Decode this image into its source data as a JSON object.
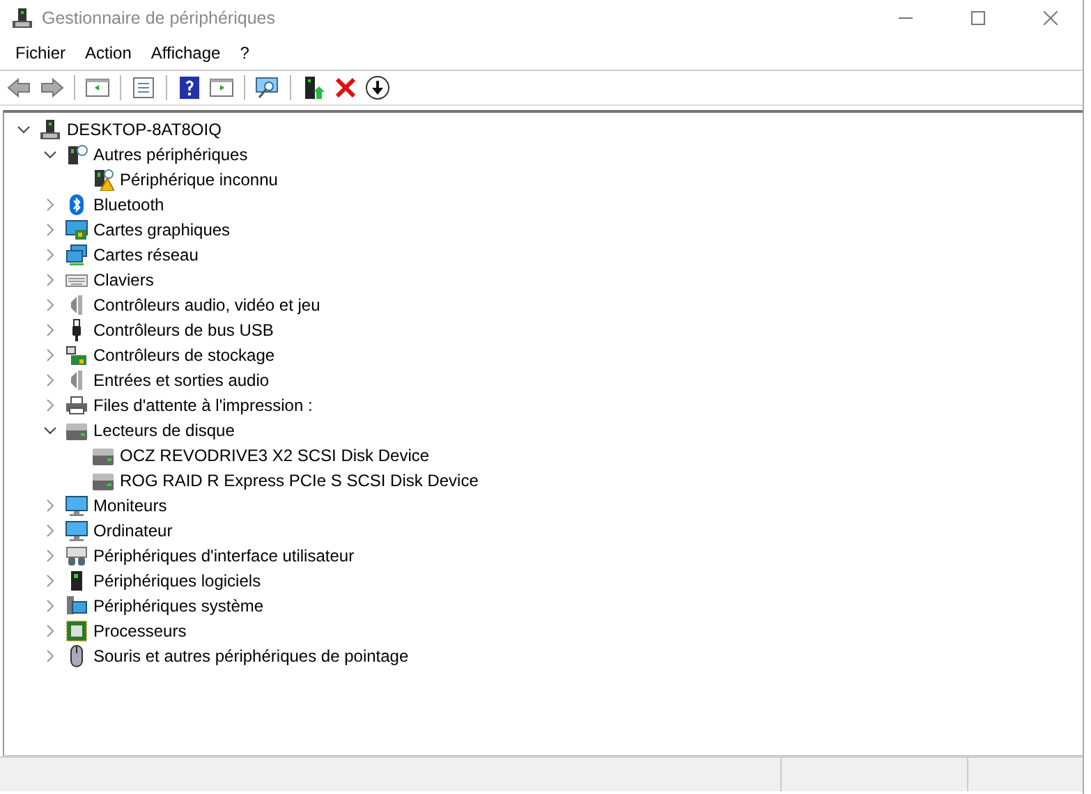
{
  "window": {
    "title": "Gestionnaire de périphériques"
  },
  "menu": [
    "Fichier",
    "Action",
    "Affichage",
    "?"
  ],
  "tree": [
    {
      "label": "DESKTOP-8AT8OIQ",
      "kind": "computer",
      "expanded": true,
      "children": [
        {
          "label": "Autres périphériques",
          "kind": "unknown",
          "expanded": true,
          "children": [
            {
              "label": "Périphérique inconnu",
              "kind": "warning"
            }
          ]
        },
        {
          "label": "Bluetooth",
          "kind": "bluetooth",
          "expanded": false
        },
        {
          "label": "Cartes graphiques",
          "kind": "display",
          "expanded": false
        },
        {
          "label": "Cartes réseau",
          "kind": "network",
          "expanded": false
        },
        {
          "label": "Claviers",
          "kind": "keyboard",
          "expanded": false
        },
        {
          "label": "Contrôleurs audio, vidéo et jeu",
          "kind": "speaker",
          "expanded": false
        },
        {
          "label": "Contrôleurs de bus USB",
          "kind": "usb",
          "expanded": false
        },
        {
          "label": "Contrôleurs de stockage",
          "kind": "storage",
          "expanded": false
        },
        {
          "label": "Entrées et sorties audio",
          "kind": "speaker",
          "expanded": false
        },
        {
          "label": "Files d'attente à l'impression :",
          "kind": "printer",
          "expanded": false
        },
        {
          "label": "Lecteurs de disque",
          "kind": "disk",
          "expanded": true,
          "children": [
            {
              "label": "OCZ REVODRIVE3 X2 SCSI Disk Device",
              "kind": "disk"
            },
            {
              "label": "ROG RAID R Express PCIe S SCSI Disk Device",
              "kind": "disk"
            }
          ]
        },
        {
          "label": "Moniteurs",
          "kind": "monitor",
          "expanded": false
        },
        {
          "label": "Ordinateur",
          "kind": "monitor",
          "expanded": false
        },
        {
          "label": "Périphériques d'interface utilisateur",
          "kind": "hid",
          "expanded": false
        },
        {
          "label": "Périphériques logiciels",
          "kind": "software",
          "expanded": false
        },
        {
          "label": "Périphériques système",
          "kind": "system",
          "expanded": false
        },
        {
          "label": "Processeurs",
          "kind": "processor",
          "expanded": false
        },
        {
          "label": "Souris et autres périphériques de pointage",
          "kind": "mouse",
          "expanded": false
        }
      ]
    }
  ]
}
